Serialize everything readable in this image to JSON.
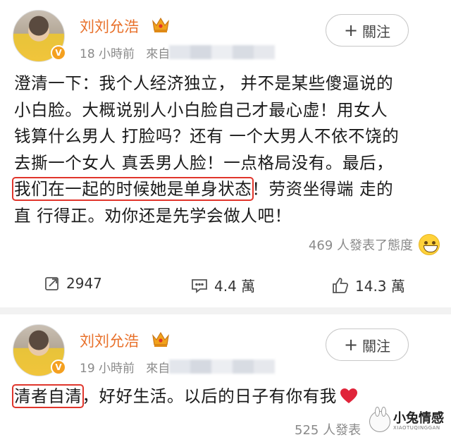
{
  "posts": [
    {
      "author": "刘刘允浩",
      "time": "18 小時前",
      "source_prefix": "來自",
      "follow_label": "關注",
      "lines": [
        "澄清一下：我个人经济独立，  并不是某些傻逼说的",
        "小白脸。大概说别人小白脸自己才最心虚！用女人",
        "钱算什么男人 打脸吗？还有 一个大男人不依不饶的",
        "去撕一个女人 真丢男人脸！一点格局没有。最后，"
      ],
      "highlight": "我们在一起的时候她是单身状态",
      "line5_rest": "！劳资坐得端 走的",
      "line6": "直 行得正。劝你还是先学会做人吧！",
      "reactions": "469 人發表了態度",
      "reposts": "2947",
      "comments": "4.4 萬",
      "likes": "14.3 萬"
    },
    {
      "author": "刘刘允浩",
      "time": "19 小時前",
      "source_prefix": "來自",
      "follow_label": "關注",
      "highlight": "清者自清",
      "text_rest": "，好好生活。以后的日子有你有我",
      "reactions": "525 人發表"
    }
  ],
  "watermark": {
    "title": "小兔情感",
    "subtitle": "XIAOTUQINGGAN"
  },
  "colors": {
    "author": "#e8702a",
    "highlight_border": "#e0352b",
    "meta": "#8a8a8a",
    "heart": "#e0243a"
  },
  "icons": [
    "crown-icon",
    "verified-badge-icon",
    "plus-icon",
    "repost-icon",
    "comment-icon",
    "like-icon",
    "smile-emoji-icon",
    "heart-icon"
  ]
}
